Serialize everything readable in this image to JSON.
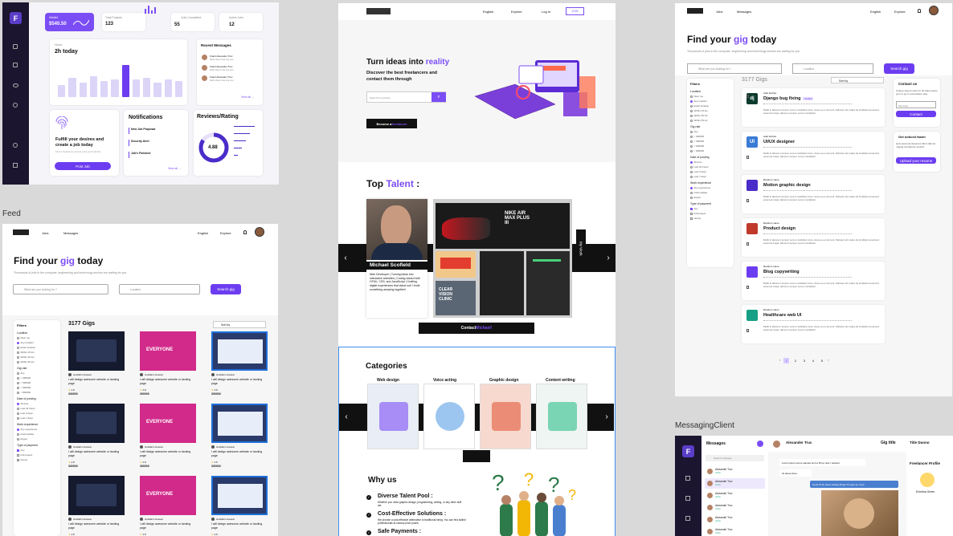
{
  "labels": {
    "feed": "Feed",
    "messaging": "MessagingClient"
  },
  "dashboard": {
    "logo": "F",
    "wallet_label": "Wallet",
    "wallet_value": "$540.50",
    "stats": [
      {
        "label": "Total Projects",
        "value": "123"
      },
      {
        "label": "Jobs Completed",
        "value": "55"
      },
      {
        "label": "Active Jobs",
        "value": "12"
      }
    ],
    "hours_title": "2h today",
    "hours_sub": "Hours",
    "bars": [
      0.35,
      0.55,
      0.4,
      0.6,
      0.45,
      0.5,
      0.9,
      0.5,
      0.55,
      0.4,
      0.5,
      0.45
    ],
    "messages_title": "Recent Messages",
    "view_all": "View all →",
    "messages": [
      {
        "name": "Franti Alexander Truc",
        "text": "Hello there how are you"
      },
      {
        "name": "Franti Alexander Truc",
        "text": "Hello there how are you"
      },
      {
        "name": "Franti Alexander Truc",
        "text": "Hello there how are you"
      }
    ],
    "fulfill_title": "Fulfill your desires and create a job today",
    "fulfill_sub": "Find a freelancer at best price and solution",
    "fulfill_btn": "Post Job",
    "notif_title": "Notifications",
    "notifs": [
      "New Job Proposal",
      "Security Alert",
      "Job's Finished"
    ],
    "reviews_title": "Reviews/Rating",
    "rating": "4.88"
  },
  "landing": {
    "nav": {
      "lang": "English",
      "explore": "Explore",
      "login": "Log In",
      "join": "JOIN"
    },
    "hero_title_a": "Turn ideas into ",
    "hero_title_b": "reality",
    "hero_sub": "Discover the best freelancers and contact them through",
    "search_placeholder": "Search for services",
    "become_a": "Become a ",
    "become_b": "freelancer",
    "talent_a": "Top ",
    "talent_b": "Talent",
    "talent_name": "Michael Scofield",
    "talent_bio": "Web Developer | Turning ideas into interactive websites | Coding wizard with HTML, CSS, and JavaScript | Crafting digital experiences that stand out! I build something amazing together!",
    "contact_a": "Contact ",
    "contact_b": "Michael!",
    "my_work": "My Work",
    "nike_text": "NIKE AIR MAX PLUS III",
    "clinic_text": "CLEAR VISION CLINIC",
    "categories_title": "Categories",
    "categories": [
      "Web design",
      "Voice acting",
      "Graphic design",
      "Content writing"
    ],
    "why_title": "Why us",
    "why": [
      {
        "title": "Diverse Talent Pool :",
        "text": "Whether you need graphic design, programming, writing, or any other skill set."
      },
      {
        "title": "Cost-Effective Solutions :",
        "text": "We provide a cost-effective alternative to traditional hiring. You can find skilled professionals at various price points."
      },
      {
        "title": "Safe Payments :",
        "text": ""
      }
    ]
  },
  "feed": {
    "nav": {
      "jobs": "Jobs",
      "messages": "Messages",
      "lang": "English",
      "explore": "Explore"
    },
    "title_a": "Find your ",
    "title_b": "gig",
    "title_c": " today",
    "subtitle": "Thousands of jobs in the computer, engineering and technology sectors are waiting for you.",
    "search_placeholder": "What are you looking for ?",
    "location_placeholder": "Location",
    "search_btn": "Search gig",
    "count": "3177 Gigs",
    "sort": "Sort by",
    "filters_title": "Filters",
    "filter_groups": [
      {
        "title": "Location",
        "items": [
          "Near me",
          "Any location",
          "Exact location",
          "Within 15 km",
          "Within 30 km",
          "Within 50 km"
        ]
      },
      {
        "title": "Gig rate",
        "items": [
          "Any",
          "< 300000",
          "< 500000",
          "< 600000",
          "< 800000"
        ]
      },
      {
        "title": "Date of posting",
        "items": [
          "All time",
          "Last 24 hours",
          "Last 3 days",
          "Last 7 days"
        ]
      },
      {
        "title": "Work experience",
        "items": [
          "Any experience",
          "Intermediate",
          "Expert"
        ]
      },
      {
        "title": "Type of payment",
        "items": [
          "Any",
          "Full-project",
          "Hourly"
        ]
      }
    ],
    "gig_seller": "Goddahm Hossein",
    "gig_title": "I will design awesome website or landing page",
    "gig_rating": "4.8",
    "gig_price": "300000",
    "everyone": "EVERYONE"
  },
  "jobs": {
    "title_a": "Find your ",
    "title_b": "gig",
    "title_c": " today",
    "subtitle": "Thousands of jobs in the computer, engineering and technology sectors are waiting for you.",
    "count": "3177 Gigs",
    "list": [
      {
        "author": "Adel Ferhan",
        "title": "Django bug fixing",
        "badge": "Verified",
        "icon": "dj",
        "color": "#0c3b2e"
      },
      {
        "author": "Adel Ferhan",
        "title": "UI/UX designer",
        "badge": "",
        "icon": "UI",
        "color": "#3a7bd5"
      },
      {
        "author": "Random name",
        "title": "Motion graphic design",
        "badge": "",
        "icon": "",
        "color": "#4a2cc9"
      },
      {
        "author": "Random name",
        "title": "Product design",
        "badge": "",
        "icon": "",
        "color": "#c0392b"
      },
      {
        "author": "Random name",
        "title": "Blog copywriting",
        "badge": "",
        "icon": "",
        "color": "#6c3df0"
      },
      {
        "author": "Random name",
        "title": "Healthcare web UI",
        "badge": "",
        "icon": "",
        "color": "#16a085"
      }
    ],
    "desc": "Mollit in laborum tempor Lorem incididunt irure. Aute eu ex ad sunt. Pariatur sint culpa do incididunt eiusmod eiusmod culpa. laborum tempor Lorem incididunt",
    "contact_title": "Contact us",
    "contact_text": "Unique speed notes for all sales teams your to go to somewhere else",
    "message_ph": "Message",
    "contact_btn": "Contact",
    "noticed_title": "Get noticed faster",
    "noticed_text": "Quis eiusmod deserunt cillum laboris magna nisi laboris nostrud",
    "upload_btn": "Upload your resume",
    "pages": [
      "1",
      "2",
      "3",
      "4",
      "5"
    ]
  },
  "messaging": {
    "logo": "F",
    "title": "Messages",
    "chat_name": "Alexander Truc",
    "gig_title": "Gig title",
    "right_title": "Title Dunno",
    "profile_title": "Freelancer Profile",
    "profile_name": "Echidna Green",
    "search": "Search message",
    "list": [
      {
        "name": "Alexander Truc",
        "s": "online"
      },
      {
        "name": "Alexander Truc",
        "s": "online"
      },
      {
        "name": "Alexander Truc",
        "s": "online"
      },
      {
        "name": "Alexander Truc",
        "s": "online"
      },
      {
        "name": "Alexander Truc",
        "s": "online"
      },
      {
        "name": "Alexander Truc",
        "s": "online"
      }
    ],
    "bubbles": [
      "Lorem ipsum some sample text to fill up post I wanted",
      "Its about done",
      "Good I'll do those testing things I'll open up more"
    ]
  }
}
